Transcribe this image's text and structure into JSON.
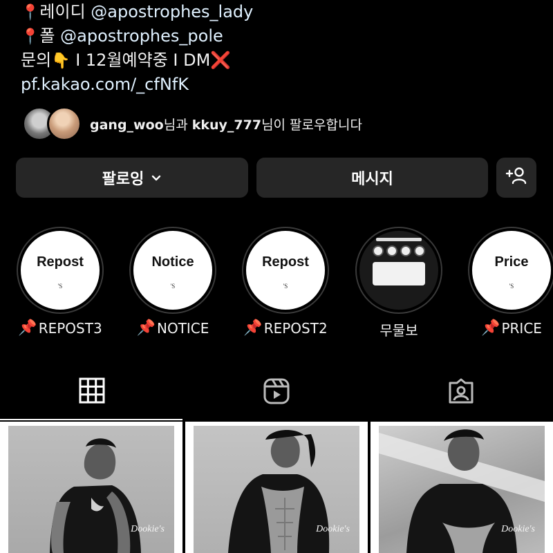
{
  "bio": {
    "line1_prefix": "레이디 ",
    "line1_mention": "@apostrophes_lady",
    "line2_prefix": "폴 ",
    "line2_mention": "@apostrophes_pole",
    "line3_a": "문의",
    "line3_b": " I 12월예약중 I DM",
    "link": "pf.kakao.com/_cfNfK"
  },
  "followed_by": {
    "user1": "gang_woo",
    "joiner": "님과 ",
    "user2": "kkuy_777",
    "suffix": "님이 팔로우합니다"
  },
  "actions": {
    "following_label": "팔로잉",
    "message_label": "메시지"
  },
  "highlights": [
    {
      "cover_title": "Repost",
      "cover_logo": "'S",
      "label": "REPOST3"
    },
    {
      "cover_title": "Notice",
      "cover_logo": "'S",
      "label": "NOTICE"
    },
    {
      "cover_title": "Repost",
      "cover_logo": "'S",
      "label": "REPOST2"
    },
    {
      "cover_title": "",
      "cover_logo": "",
      "label": "무물보"
    },
    {
      "cover_title": "Price",
      "cover_logo": "'S",
      "label": "PRICE"
    }
  ],
  "posts": [
    {
      "watermark": "Dookie's"
    },
    {
      "watermark": "Dookie's"
    },
    {
      "watermark": "Dookie's"
    }
  ],
  "icons": {
    "pin": "round-pushpin-icon",
    "hand": "backhand-index-pointing-down-icon",
    "cross": "cross-mark-icon",
    "chevron": "chevron-down-icon",
    "add_person": "add-person-icon",
    "grid": "grid-icon",
    "reels": "reels-icon",
    "tagged": "tagged-icon"
  },
  "colors": {
    "background": "#000000",
    "button": "#262626",
    "text": "#ffffff"
  }
}
